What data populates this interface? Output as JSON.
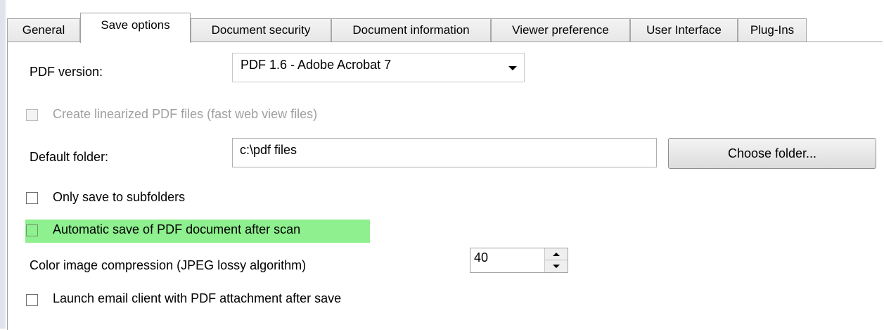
{
  "tabs": [
    {
      "label": "General"
    },
    {
      "label": "Save options",
      "active": true
    },
    {
      "label": "Document security"
    },
    {
      "label": "Document information"
    },
    {
      "label": "Viewer preference"
    },
    {
      "label": "User Interface"
    },
    {
      "label": "Plug-Ins"
    }
  ],
  "save_options": {
    "pdf_version_label": "PDF version:",
    "pdf_version_value": "PDF 1.6 - Adobe Acrobat 7",
    "linearized_label": "Create linearized PDF files (fast web view files)",
    "linearized_checked": false,
    "linearized_enabled": false,
    "default_folder_label": "Default folder:",
    "default_folder_value": "c:\\pdf files",
    "choose_folder_button": "Choose folder...",
    "only_subfolders_label": "Only save to subfolders",
    "only_subfolders_checked": false,
    "auto_save_label": "Automatic save of PDF document after scan",
    "auto_save_checked": false,
    "highlight_color": "#8ef08e",
    "compression_label": "Color image compression (JPEG lossy algorithm)",
    "compression_value": "40",
    "launch_email_label": "Launch email client with PDF attachment after save",
    "launch_email_checked": false
  }
}
